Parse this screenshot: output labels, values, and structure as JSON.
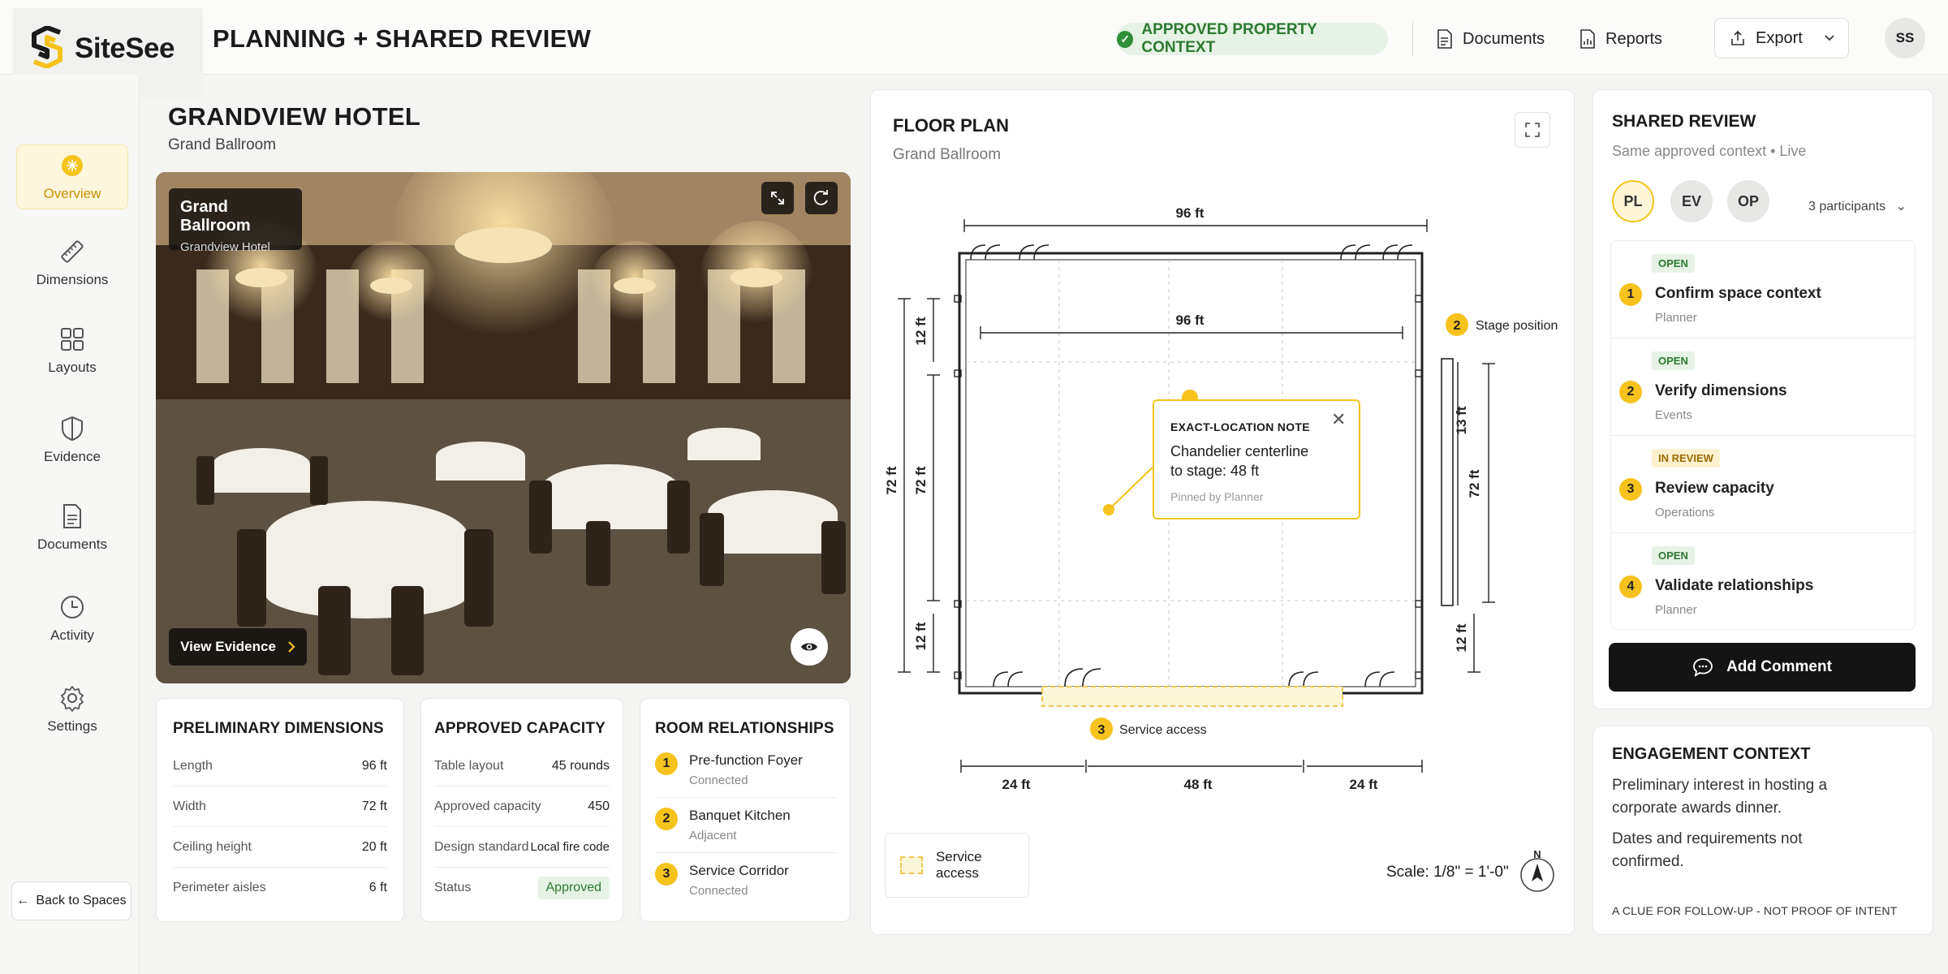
{
  "app": {
    "name": "SiteSee",
    "page_title": "PLANNING + SHARED REVIEW"
  },
  "header": {
    "approved_badge": "APPROVED PROPERTY CONTEXT",
    "documents_label": "Documents",
    "reports_label": "Reports",
    "export_label": "Export",
    "avatar_initials": "SS"
  },
  "sidebar": {
    "items": [
      {
        "label": "Overview",
        "icon": "overview-icon",
        "active": true
      },
      {
        "label": "Dimensions",
        "icon": "ruler-icon"
      },
      {
        "label": "Layouts",
        "icon": "grid-icon"
      },
      {
        "label": "Evidence",
        "icon": "shield-icon"
      },
      {
        "label": "Documents",
        "icon": "document-icon"
      },
      {
        "label": "Activity",
        "icon": "clock-icon"
      },
      {
        "label": "Settings",
        "icon": "gear-icon"
      }
    ],
    "back_label": "Back to Spaces"
  },
  "venue": {
    "name": "GRANDVIEW HOTEL",
    "room": "Grand Ballroom",
    "photo_label_title": "Grand Ballroom",
    "photo_label_sub": "Grandview Hotel",
    "view_evidence_label": "View Evidence"
  },
  "dimensions": {
    "title": "PRELIMINARY DIMENSIONS",
    "rows": [
      {
        "k": "Length",
        "v": "96 ft"
      },
      {
        "k": "Width",
        "v": "72 ft"
      },
      {
        "k": "Ceiling height",
        "v": "20 ft"
      },
      {
        "k": "Perimeter aisles",
        "v": "6 ft"
      }
    ]
  },
  "capacity": {
    "title": "APPROVED CAPACITY",
    "rows": [
      {
        "k": "Table layout",
        "v": "45 rounds"
      },
      {
        "k": "Approved capacity",
        "v": "450"
      },
      {
        "k": "Design standard",
        "v": "Local fire code"
      },
      {
        "k": "Status",
        "v": "Approved"
      }
    ]
  },
  "relationships": {
    "title": "ROOM RELATIONSHIPS",
    "rows": [
      {
        "num": "1",
        "name": "Pre-function Foyer",
        "sub": "Connected"
      },
      {
        "num": "2",
        "name": "Banquet Kitchen",
        "sub": "Adjacent"
      },
      {
        "num": "3",
        "name": "Service Corridor",
        "sub": "Connected"
      }
    ]
  },
  "floor_plan": {
    "title": "FLOOR PLAN",
    "subtitle": "Grand Ballroom",
    "dim_top": "96 ft",
    "dim_inner": "96 ft",
    "dim_left_outer": "72 ft",
    "dim_left_inner": "72 ft",
    "dim_left_top": "12 ft",
    "dim_left_bottom": "12 ft",
    "dim_right_mid": "72 ft",
    "dim_right_top": "13 ft",
    "dim_right_bottom": "12 ft",
    "dim_bottom": [
      "24 ft",
      "48 ft",
      "24 ft"
    ],
    "marker_2_num": "2",
    "marker_2_label": "Stage position",
    "marker_3_num": "3",
    "marker_3_label": "Service access",
    "note_title": "EXACT-LOCATION NOTE",
    "note_body": "Chandelier centerline to stage: 48 ft",
    "note_pinned": "Pinned by Planner",
    "legend_label": "Service access",
    "scale": "Scale: 1/8\" = 1'-0\"",
    "north": "N"
  },
  "shared_review": {
    "title": "SHARED REVIEW",
    "subtitle": "Same approved context  •  Live",
    "participants": [
      "PL",
      "EV",
      "OP"
    ],
    "participants_label": "3 participants",
    "items": [
      {
        "num": "1",
        "tag": "OPEN",
        "title": "Confirm space context",
        "owner": "Planner"
      },
      {
        "num": "2",
        "tag": "OPEN",
        "title": "Verify dimensions",
        "owner": "Events"
      },
      {
        "num": "3",
        "tag": "IN REVIEW",
        "title": "Review capacity",
        "owner": "Operations"
      },
      {
        "num": "4",
        "tag": "OPEN",
        "title": "Validate relationships",
        "owner": "Planner"
      }
    ],
    "add_comment_label": "Add Comment"
  },
  "engagement": {
    "title": "ENGAGEMENT CONTEXT",
    "p1": "Preliminary interest in hosting a corporate awards dinner.",
    "p2": "Dates and requirements not confirmed.",
    "footnote": "A CLUE FOR FOLLOW-UP - NOT PROOF OF INTENT"
  },
  "colors": {
    "accent": "#f6c21c",
    "approved": "#2c7a31",
    "dark": "#141414"
  }
}
